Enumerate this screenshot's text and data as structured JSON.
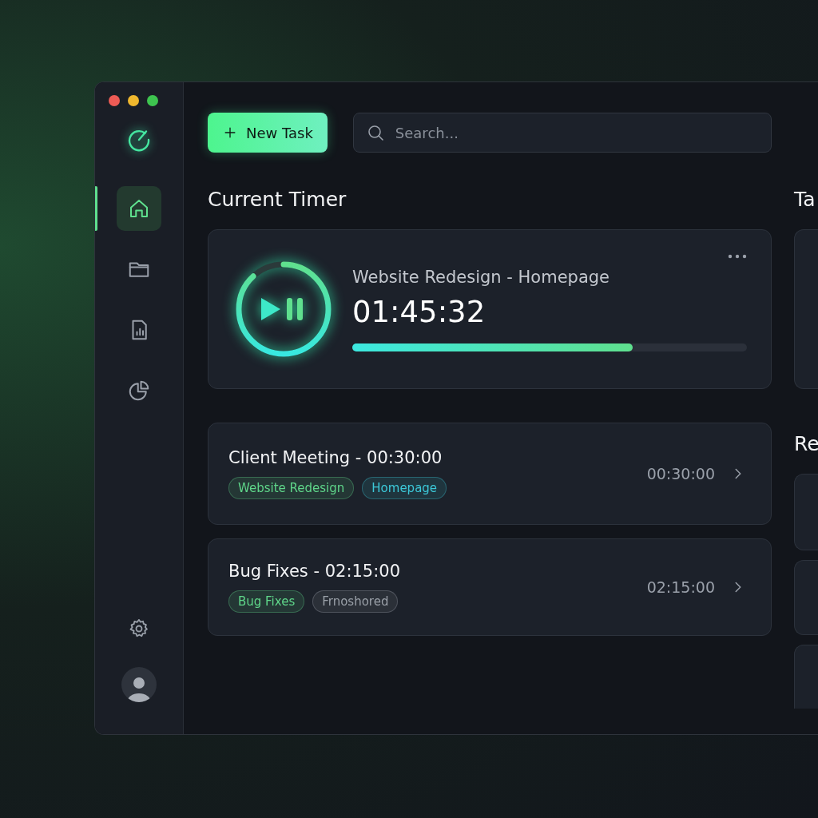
{
  "sidebar": {
    "items": [
      {
        "kind": "home",
        "selected": true
      },
      {
        "kind": "folder",
        "selected": false
      },
      {
        "kind": "report",
        "selected": false
      },
      {
        "kind": "chart",
        "selected": false
      }
    ]
  },
  "toolbar": {
    "new_task": "New Task",
    "search": {
      "placeholder": "Search..."
    }
  },
  "current_timer": {
    "heading": "Current Timer",
    "task": "Website Redesign - Homepage",
    "time": "01:45:32",
    "ring": {
      "level": 0.88
    },
    "progress": {
      "level": 0.71
    }
  },
  "tasks": [
    {
      "title": "Client Meeting - 00:30:00",
      "duration": "00:30:00",
      "tags": [
        {
          "label": "Website Redesign",
          "color": "#5fd68a"
        },
        {
          "label": "Homepage",
          "color": "#3cc8d8"
        }
      ]
    },
    {
      "title": "Bug Fixes - 02:15:00",
      "duration": "02:15:00",
      "tags": [
        {
          "label": "Bug Fixes",
          "color": "#5fd68a"
        },
        {
          "label": "Frnoshored",
          "color": "#9aa0a8"
        }
      ]
    }
  ],
  "right_panel": {
    "top_heading": "Ta",
    "bottom_heading": "Re"
  }
}
